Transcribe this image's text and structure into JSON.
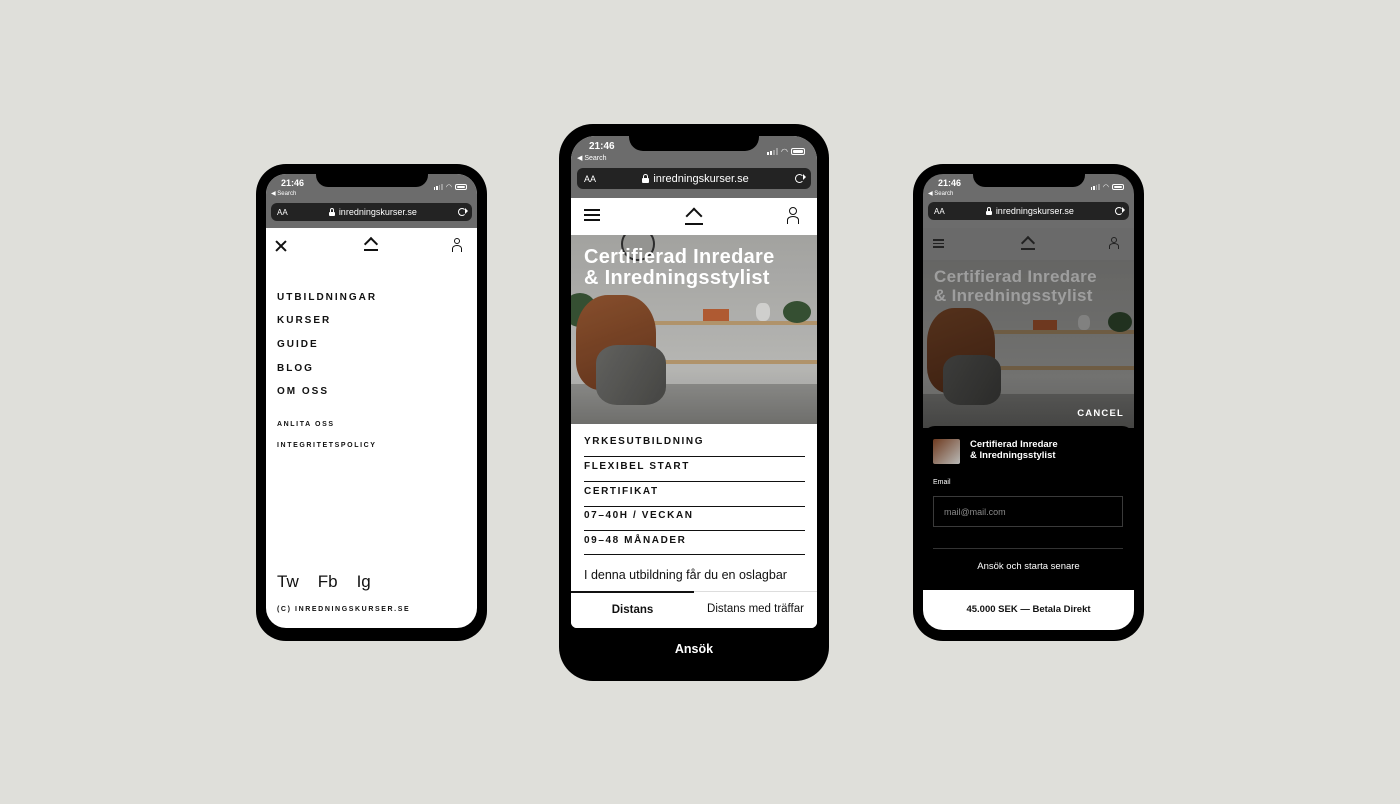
{
  "status": {
    "time": "21:46",
    "back_label": "◀ Search",
    "url": "inredningskurser.se",
    "aa_label": "AA"
  },
  "menu_phone": {
    "close_icon": "close-icon",
    "nav_items": [
      "UTBILDNINGAR",
      "KURSER",
      "GUIDE",
      "BLOG",
      "OM OSS"
    ],
    "secondary_items": [
      "ANLITA OSS",
      "INTEGRITETSPOLICY"
    ],
    "social": [
      "Tw",
      "Fb",
      "Ig"
    ],
    "copyright": "(C) INREDNINGSKURSER.SE"
  },
  "course_phone": {
    "hero_title_line1": "Certifierad Inredare",
    "hero_title_line2": "& Inredningsstylist",
    "features": [
      "YRKESUTBILDNING",
      "FLEXIBEL START",
      "CERTIFIKAT",
      "07–40H / VECKAN",
      "09–48 MÅNADER"
    ],
    "intro_text": "I denna utbildning får du en oslagbar",
    "tabs": [
      "Distans",
      "Distans med träffar"
    ],
    "active_tab": "Distans",
    "apply_label": "Ansök"
  },
  "checkout_phone": {
    "hero_title_line1": "Certifierad Inredare",
    "hero_title_line2": "& Inredningsstylist",
    "cancel_label": "CANCEL",
    "product_line1": "Certifierad Inredare",
    "product_line2": "& Inredningsstylist",
    "email_label": "Email",
    "email_placeholder": "mail@mail.com",
    "later_label": "Ansök och starta senare",
    "pay_label": "45.000 SEK — Betala Direkt"
  },
  "colors": {
    "background": "#dfdfda",
    "phone_frame": "#000000",
    "status_bar": "#6c6c6c",
    "accent_leather": "#8a4a27"
  }
}
